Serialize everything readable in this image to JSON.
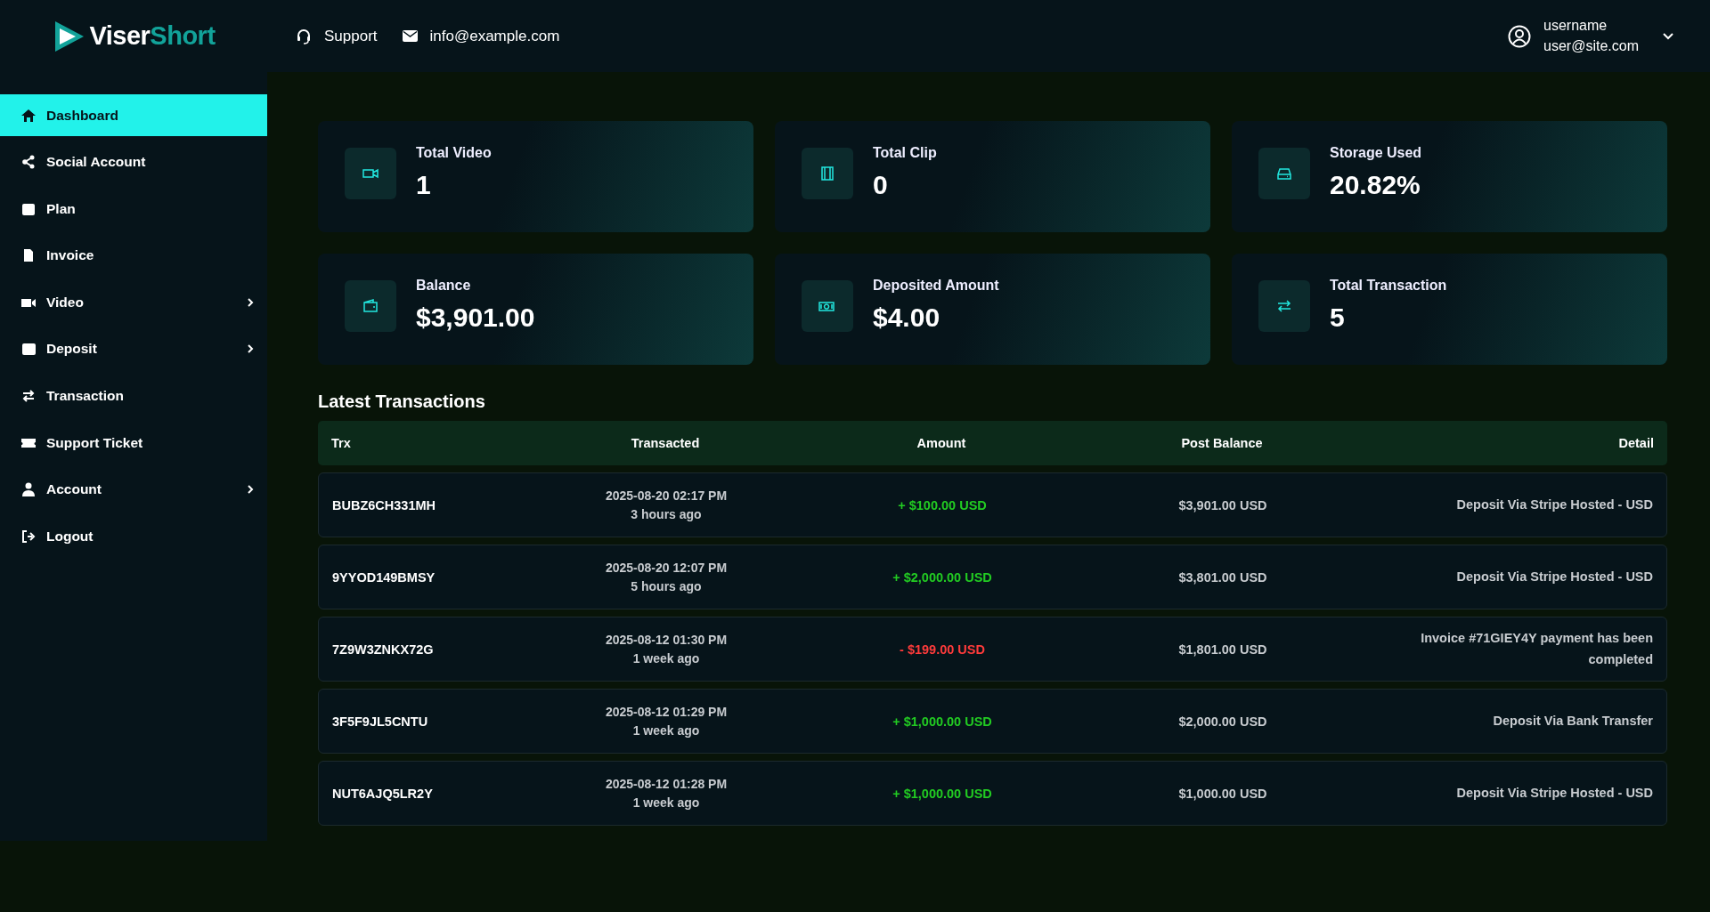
{
  "header": {
    "logo": [
      "Viser",
      "Short"
    ],
    "support": "Support",
    "email": "info@example.com",
    "user": {
      "name": "username",
      "email": "user@site.com"
    }
  },
  "sidebar": {
    "items": [
      {
        "label": "Dashboard",
        "selected": true,
        "expandable": false
      },
      {
        "label": "Social Account",
        "selected": false,
        "expandable": false
      },
      {
        "label": "Plan",
        "selected": false,
        "expandable": false
      },
      {
        "label": "Invoice",
        "selected": false,
        "expandable": false
      },
      {
        "label": "Video",
        "selected": false,
        "expandable": true
      },
      {
        "label": "Deposit",
        "selected": false,
        "expandable": true
      },
      {
        "label": "Transaction",
        "selected": false,
        "expandable": false
      },
      {
        "label": "Support Ticket",
        "selected": false,
        "expandable": false
      },
      {
        "label": "Account",
        "selected": false,
        "expandable": true
      },
      {
        "label": "Logout",
        "selected": false,
        "expandable": false
      }
    ]
  },
  "stats": [
    {
      "title": "Total Video",
      "value": "1"
    },
    {
      "title": "Total Clip",
      "value": "0"
    },
    {
      "title": "Storage Used",
      "value": "20.82%"
    },
    {
      "title": "Balance",
      "value": "$3,901.00"
    },
    {
      "title": "Deposited Amount",
      "value": "$4.00"
    },
    {
      "title": "Total Transaction",
      "value": "5"
    }
  ],
  "transactions": {
    "title": "Latest Transactions",
    "columns": [
      "Trx",
      "Transacted",
      "Amount",
      "Post Balance",
      "Detail"
    ],
    "rows": [
      {
        "trx": "BUBZ6CH331MH",
        "date": "2025-08-20 02:17 PM",
        "ago": "3 hours ago",
        "amount": "+ $100.00 USD",
        "kind": "credit",
        "post_balance": "$3,901.00 USD",
        "detail": "Deposit Via Stripe Hosted - USD"
      },
      {
        "trx": "9YYOD149BMSY",
        "date": "2025-08-20 12:07 PM",
        "ago": "5 hours ago",
        "amount": "+ $2,000.00 USD",
        "kind": "credit",
        "post_balance": "$3,801.00 USD",
        "detail": "Deposit Via Stripe Hosted - USD"
      },
      {
        "trx": "7Z9W3ZNKX72G",
        "date": "2025-08-12 01:30 PM",
        "ago": "1 week ago",
        "amount": "- $199.00 USD",
        "kind": "debit",
        "post_balance": "$1,801.00 USD",
        "detail": "Invoice #71GIEY4Y payment has been completed"
      },
      {
        "trx": "3F5F9JL5CNTU",
        "date": "2025-08-12 01:29 PM",
        "ago": "1 week ago",
        "amount": "+ $1,000.00 USD",
        "kind": "credit",
        "post_balance": "$2,000.00 USD",
        "detail": "Deposit Via Bank Transfer"
      },
      {
        "trx": "NUT6AJQ5LR2Y",
        "date": "2025-08-12 01:28 PM",
        "ago": "1 week ago",
        "amount": "+ $1,000.00 USD",
        "kind": "credit",
        "post_balance": "$1,000.00 USD",
        "detail": "Deposit Via Stripe Hosted - USD"
      }
    ]
  }
}
